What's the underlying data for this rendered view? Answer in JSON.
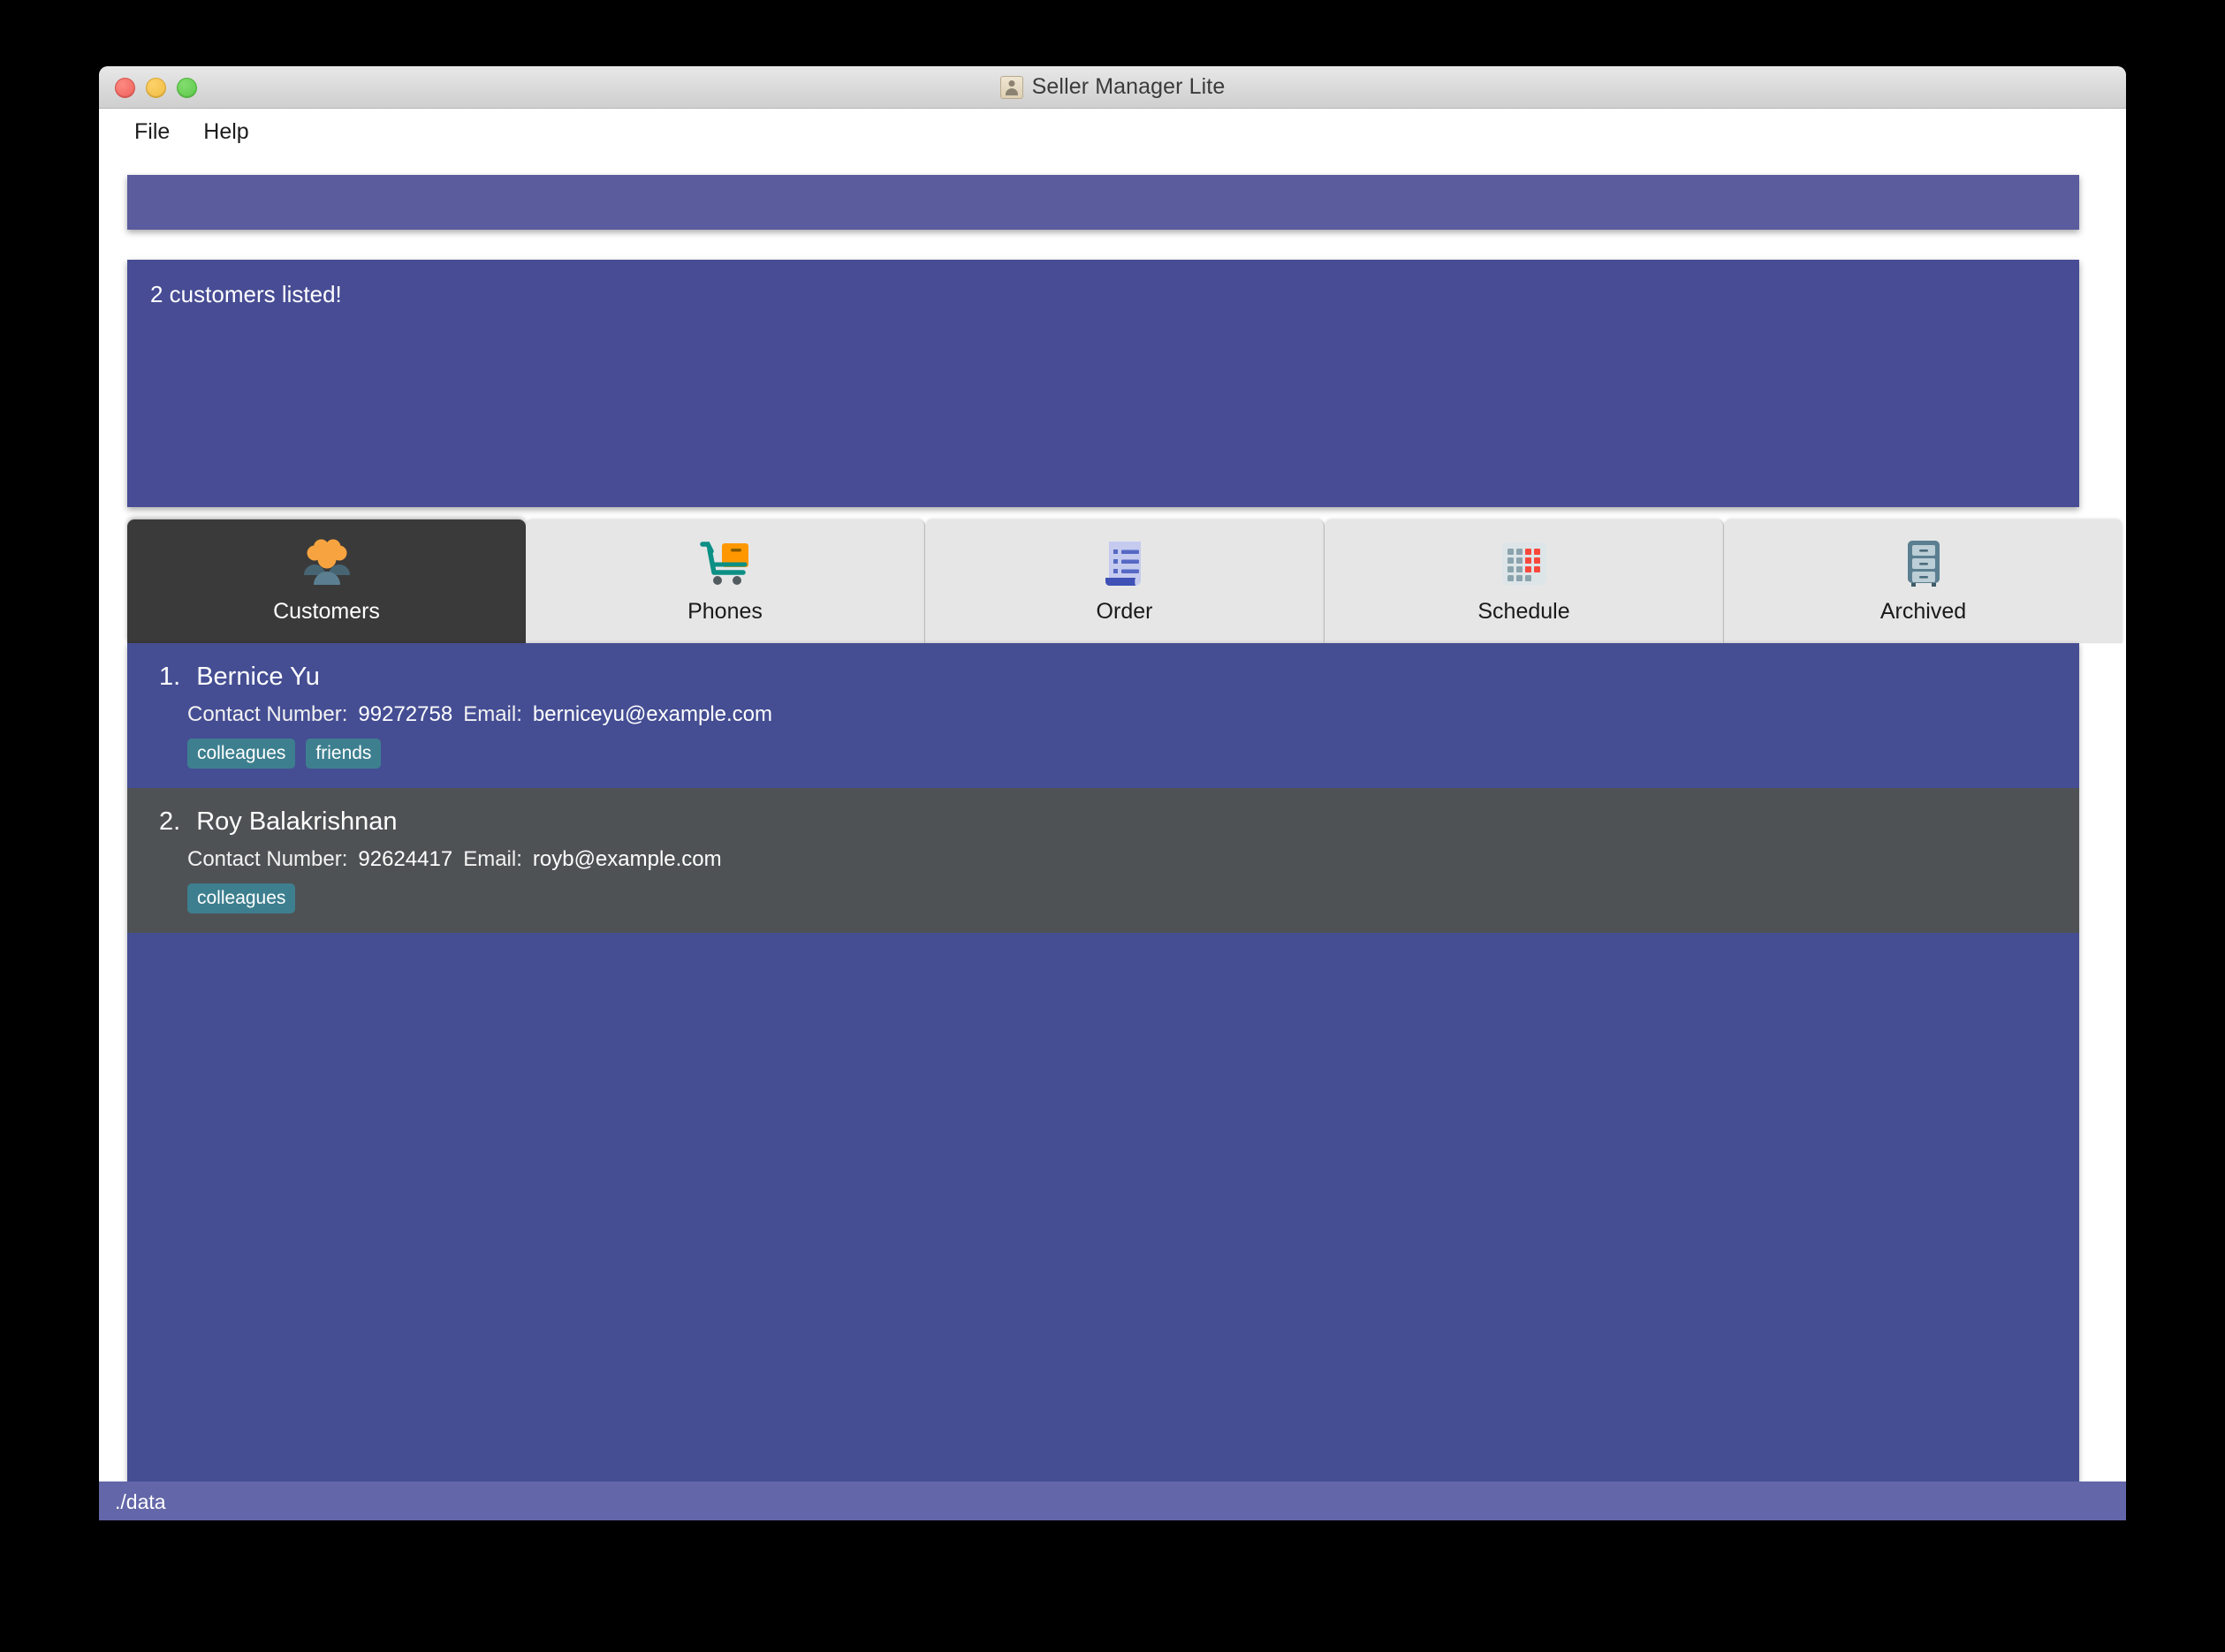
{
  "window": {
    "title": "Seller Manager Lite",
    "title_icon": "person-card-icon",
    "traffic_lights": [
      "close-button",
      "minimize-button",
      "maximize-button"
    ]
  },
  "menubar": {
    "items": [
      {
        "label": "File"
      },
      {
        "label": "Help"
      }
    ]
  },
  "command_box": {
    "value": "",
    "placeholder": ""
  },
  "result_display": {
    "message": "2 customers listed!"
  },
  "tabs": [
    {
      "label": "Customers",
      "icon": "people-group-icon",
      "active": true
    },
    {
      "label": "Phones",
      "icon": "shopping-cart-icon",
      "active": false
    },
    {
      "label": "Order",
      "icon": "receipt-document-icon",
      "active": false
    },
    {
      "label": "Schedule",
      "icon": "calendar-grid-icon",
      "active": false
    },
    {
      "label": "Archived",
      "icon": "file-cabinet-icon",
      "active": false
    }
  ],
  "list": {
    "labels": {
      "contact_number": "Contact Number:",
      "email": "Email:"
    },
    "items": [
      {
        "index": "1.",
        "name": "Bernice Yu",
        "contact_number": "99272758",
        "email": "berniceyu@example.com",
        "tags": [
          "colleagues",
          "friends"
        ]
      },
      {
        "index": "2.",
        "name": "Roy Balakrishnan",
        "contact_number": "92624417",
        "email": "royb@example.com",
        "tags": [
          "colleagues"
        ]
      }
    ]
  },
  "statusbar": {
    "path": "./data"
  },
  "colors": {
    "accent_indigo": "#454e93",
    "command_box": "#5a5c9e",
    "result_panel": "#474c94",
    "row_alt": "#4f5254",
    "tag_teal": "#3d7f8f",
    "status_bar": "#6366a8",
    "tab_active": "#3a3a3a",
    "tab_inactive": "#e6e6e6"
  }
}
